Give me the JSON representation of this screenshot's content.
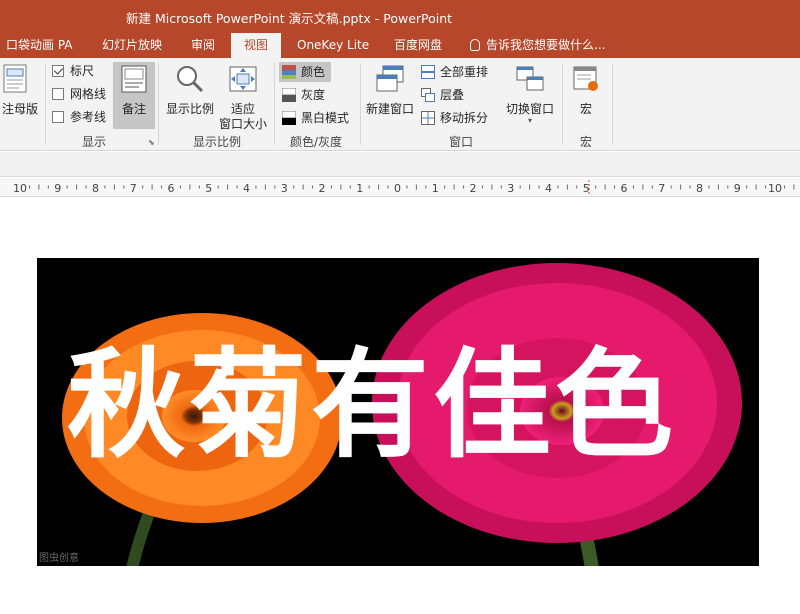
{
  "window": {
    "title": "新建 Microsoft PowerPoint 演示文稿.pptx - PowerPoint"
  },
  "tabs": [
    {
      "label": "口袋动画 PA"
    },
    {
      "label": "幻灯片放映"
    },
    {
      "label": "审阅"
    },
    {
      "label": "视图",
      "active": true
    },
    {
      "label": "OneKey Lite"
    },
    {
      "label": "百度网盘"
    }
  ],
  "tell_me": {
    "placeholder": "告诉我您想要做什么..."
  },
  "ribbon": {
    "master": {
      "notes_master_label": "注母版"
    },
    "show": {
      "group_label": "显示",
      "ruler_label": "标尺",
      "ruler_checked": true,
      "gridlines_label": "网格线",
      "gridlines_checked": false,
      "guides_label": "参考线",
      "guides_checked": false,
      "notes_label": "备注"
    },
    "zoom": {
      "group_label": "显示比例",
      "zoom_label": "显示比例",
      "fit_line1": "适应",
      "fit_line2": "窗口大小"
    },
    "color": {
      "group_label": "颜色/灰度",
      "color_label": "颜色",
      "grayscale_label": "灰度",
      "bw_label": "黑白模式"
    },
    "window": {
      "group_label": "窗口",
      "new_window_label": "新建窗口",
      "arrange_all_label": "全部重排",
      "cascade_label": "层叠",
      "move_split_label": "移动拆分",
      "switch_windows_label": "切换窗口"
    },
    "macros": {
      "group_label": "宏",
      "macros_label": "宏"
    }
  },
  "ruler": {
    "labels": [
      "10",
      "9",
      "8",
      "7",
      "6",
      "5",
      "4",
      "3",
      "2",
      "1",
      "0",
      "1",
      "2",
      "3",
      "4",
      "5",
      "6",
      "7",
      "8",
      "9",
      "10"
    ]
  },
  "slide": {
    "headline": "秋菊有佳色",
    "watermark": "图虫创意"
  },
  "colors": {
    "accent": "#b7472a",
    "ribbon_bg": "#f3f3f3",
    "flower_orange": "#f47a1f",
    "flower_pink": "#e0166a"
  }
}
